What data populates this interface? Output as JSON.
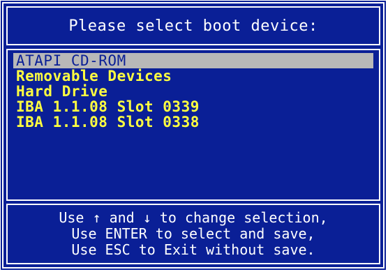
{
  "title": "Please select boot device:",
  "boot_devices": [
    {
      "label": "ATAPI CD-ROM",
      "selected": true
    },
    {
      "label": "Removable Devices",
      "selected": false
    },
    {
      "label": "Hard Drive",
      "selected": false
    },
    {
      "label": "IBA 1.1.08 Slot 0339",
      "selected": false
    },
    {
      "label": "IBA 1.1.08 Slot 0338",
      "selected": false
    }
  ],
  "help": {
    "line1": "Use ↑ and ↓ to change selection,",
    "line2": "Use ENTER to select and save,",
    "line3": "Use ESC to Exit without save."
  },
  "colors": {
    "background": "#0a1f96",
    "border": "#ffffff",
    "item_text": "#ffff40",
    "selected_bg": "#b8b8b8"
  }
}
